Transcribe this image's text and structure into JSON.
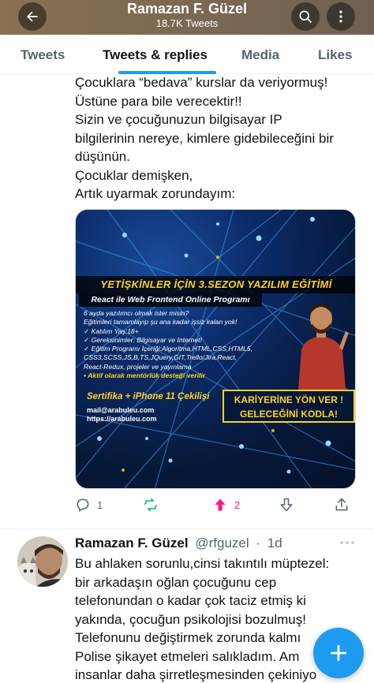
{
  "header": {
    "title": "Ramazan F. Güzel",
    "subtitle": "18.7K Tweets"
  },
  "tabs": [
    {
      "label": "Tweets"
    },
    {
      "label": "Tweets & replies"
    },
    {
      "label": "Media"
    },
    {
      "label": "Likes"
    }
  ],
  "tweet1": {
    "text": "Çocuklara “bedava” kurslar da veriyormuş!\nÜstüne para bile verecektir!!\nSizin ve çocuğunuzun bilgisayar IP\nbilgilerinin nereye, kimlere gidebileceğini bir\ndüşünün.\nÇocuklar demişken,\nArtık uyarmak zorundayım:",
    "media": {
      "title": "YETİŞKİNLER İÇİN 3.SEZON YAZILIM EĞİTİMİ",
      "subtitle": "React ile Web Frontend Online Programı",
      "lines": [
        "6 ayda yazılımcı olmak ister misin?",
        "Eğitimleri tamamlayıp şu ana kadar işsiz kalan yok!",
        "✓ Katılım Yaş:18+",
        "✓ Gereksinimler: Bilgisayar ve Internet!",
        "✓ Eğitim Programı İçeriği:Algoritma,HTML,CSS,HTML5,",
        "CSS3,SCSS,JS,B,TS,JQuery,GIT,Trello/Jira,React,",
        "React-Redux, projeler ve yayınlama",
        "• Aktif olarak mentörlük desteği verilir"
      ],
      "cert": "Sertifika + iPhone 11 Çekilişi",
      "contact": [
        "mail@arabuleu.com",
        "https://arabuleu.com"
      ],
      "cta": [
        "KARİYERİNE YÖN VER !",
        "GELECEĞİNİ KODLA!"
      ]
    },
    "replies": "1",
    "retweets": "",
    "upvotes": "2"
  },
  "tweet2": {
    "name": "Ramazan F. Güzel",
    "handle": "@rfguzel",
    "sep": "·",
    "time": "1d",
    "text": "Bu ahlaken sorunlu,cinsi takıntılı müptezel:\nbir arkadaşın oğlan çocuğunu cep\ntelefonundan o kadar çok taciz etmiş ki\nyakında, çocuğun psikolojisi bozulmuş!\nTelefonunu değiştirmek zorunda kalmı\nPolise şikayet etmeleri salıkladım. Am\ninsanlar daha şirretleşmesinden çekiniyo"
  },
  "colors": {
    "accent": "#1d9bf0",
    "retweet": "#00ba7c",
    "upvote": "#f91880",
    "muted": "#536471"
  },
  "icons": {
    "back": "arrow-left-icon",
    "search": "search-icon",
    "more": "more-icon",
    "reply": "reply-icon",
    "retweet": "retweet-icon",
    "upvote": "upvote-icon",
    "downvote": "downvote-icon",
    "share": "share-icon",
    "compose": "plus-icon"
  }
}
